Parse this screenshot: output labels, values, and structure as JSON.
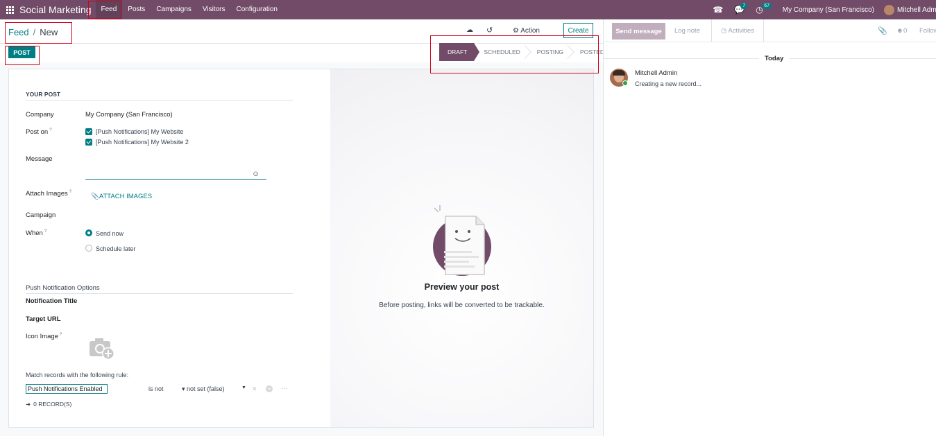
{
  "navbar": {
    "app_name": "Social Marketing",
    "menu": [
      "Feed",
      "Posts",
      "Campaigns",
      "Visitors",
      "Configuration"
    ],
    "messages_badge": "7",
    "activities_badge": "67",
    "company": "My Company (San Francisco)",
    "user": "Mitchell Admin"
  },
  "control_panel": {
    "breadcrumb_parent": "Feed",
    "breadcrumb_current": "New",
    "action_label": "Action",
    "create_label": "Create",
    "post_label": "POST",
    "stages": [
      "DRAFT",
      "SCHEDULED",
      "POSTING",
      "POSTED"
    ],
    "active_stage": "DRAFT"
  },
  "form": {
    "section_title": "YOUR POST",
    "company_label": "Company",
    "company_value": "My Company (San Francisco)",
    "post_on_label": "Post on",
    "post_on_tooltip": "?",
    "accounts": [
      "[Push Notifications] My Website",
      "[Push Notifications] My Website 2"
    ],
    "message_label": "Message",
    "attach_images_label": "Attach Images",
    "attach_images_link": "ATTACH IMAGES",
    "campaign_label": "Campaign",
    "when_label": "When",
    "when_options": [
      "Send now",
      "Schedule later"
    ],
    "when_selected": "Send now",
    "push_options_title": "Push Notification Options",
    "notification_title_label": "Notification Title",
    "target_url_label": "Target URL",
    "icon_image_label": "Icon Image",
    "rule_label": "Match records with the following rule:",
    "rule_field": "Push Notifications Enabled",
    "rule_operator": "is not",
    "rule_value": "not set (false)",
    "records_link": "0 RECORD(S)"
  },
  "preview": {
    "title": "Preview your post",
    "subtitle": "Before posting, links will be converted to be trackable."
  },
  "chatter": {
    "send_message": "Send message",
    "log_note": "Log note",
    "activities": "Activities",
    "followers_count": "0",
    "follow": "Follow",
    "date_separator": "Today",
    "message_author": "Mitchell Admin",
    "message_body": "Creating a new record..."
  },
  "colors": {
    "brand": "#714b67",
    "accent": "#017e84",
    "annotation": "#d0021b"
  }
}
